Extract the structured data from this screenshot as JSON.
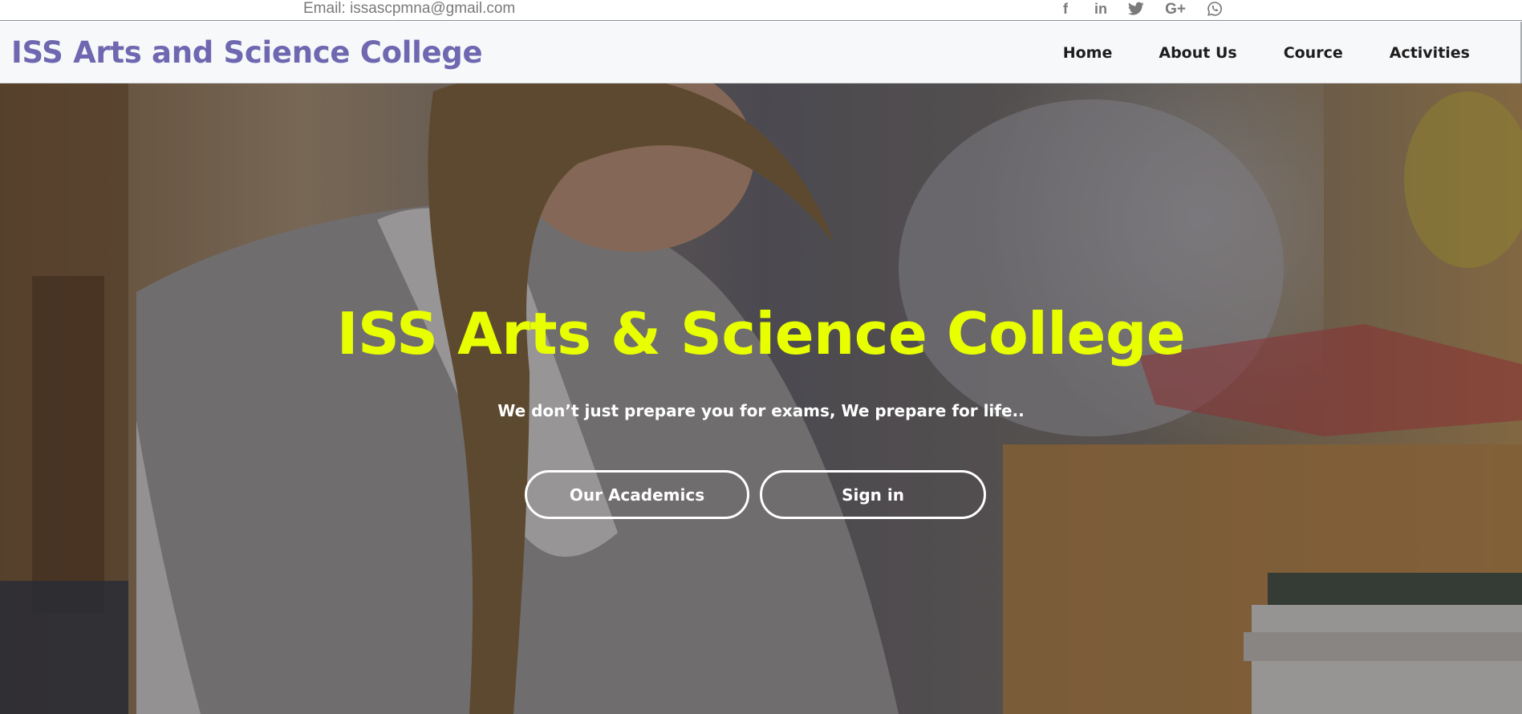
{
  "topbar": {
    "email": "Email: issascpmna@gmail.com",
    "social_icons": [
      "facebook-icon",
      "linkedin-icon",
      "twitter-icon",
      "google-plus-icon",
      "whatsapp-icon"
    ],
    "social_glyphs": {
      "facebook": "f",
      "linkedin": "in",
      "twitter": "t",
      "google_plus": "G+",
      "whatsapp": "w"
    }
  },
  "navbar": {
    "brand": "ISS Arts and Science College",
    "items": [
      {
        "label": "Home"
      },
      {
        "label": "About Us"
      },
      {
        "label": "Cource"
      },
      {
        "label": "Activities"
      }
    ]
  },
  "hero": {
    "title": "ISS Arts & Science College",
    "subtitle": "We don’t just prepare you for exams, We prepare for life..",
    "buttons": [
      {
        "label": "Our Academics"
      },
      {
        "label": "Sign in"
      }
    ]
  },
  "colors": {
    "brand": "#6f67b0",
    "hero_title": "#e8ff00",
    "nav_text": "#1d1d1d",
    "muted": "#7a7a7a"
  }
}
